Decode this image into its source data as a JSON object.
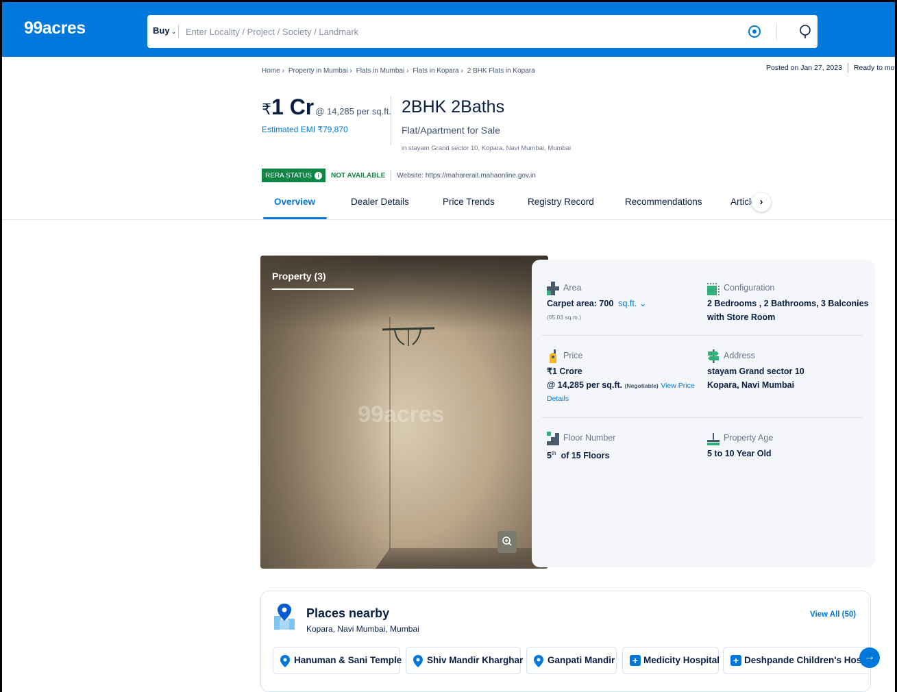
{
  "header": {
    "logo": "99acres",
    "buy_label": "Buy",
    "search_placeholder": "Enter Locality / Project / Society / Landmark"
  },
  "breadcrumb": [
    "Home",
    "Property in Mumbai",
    "Flats in Mumbai",
    "Flats in Kopara",
    "2 BHK Flats in Kopara"
  ],
  "posted": {
    "date": "Posted on Jan 27, 2023",
    "status": "Ready to move"
  },
  "summary": {
    "rupee": "₹",
    "price": "1 Cr",
    "per_sqft": "@ 14,285 per sq.ft.",
    "emi": "Estimated EMI ₹79,870",
    "bhk": "2BHK 2Baths",
    "property_type": "Flat/Apartment for Sale",
    "location": "in stayam Grand sector 10, Kopara, Navi Mumbai, Mumbai"
  },
  "rera": {
    "badge": "RERA STATUS",
    "status": "NOT AVAILABLE",
    "website": "Website: https://maharerait.mahaonline.gov.in"
  },
  "tabs": [
    "Overview",
    "Dealer Details",
    "Price Trends",
    "Registry Record",
    "Recommendations",
    "Article"
  ],
  "gallery": {
    "title": "Property (3)",
    "watermark": "99acres"
  },
  "details": {
    "area": {
      "label": "Area",
      "value": "Carpet area: 700",
      "unit": "sq.ft.",
      "sub": "(65.03 sq.m.)"
    },
    "configuration": {
      "label": "Configuration",
      "line1": "2 Bedrooms , 2 Bathrooms, 3 Balconies",
      "line2": "with Store Room"
    },
    "price": {
      "label": "Price",
      "value": "₹1 Crore",
      "per_sqft": "@ 14,285 per sq.ft.",
      "negotiable": "(Negotiable)",
      "link1": "View Price",
      "link2": "Details"
    },
    "address": {
      "label": "Address",
      "line1": "stayam Grand sector 10",
      "line2": "Kopara, Navi Mumbai"
    },
    "floor": {
      "label": "Floor Number",
      "value": "5",
      "sup": "th",
      "rest": "of 15 Floors"
    },
    "age": {
      "label": "Property Age",
      "value": "5 to 10 Year Old"
    }
  },
  "places": {
    "title": "Places nearby",
    "subtitle": "Kopara, Navi Mumbai, Mumbai",
    "view_all": "View All (50)",
    "chips": [
      {
        "label": "Hanuman & Sani Temple",
        "icon": "pin-icon"
      },
      {
        "label": "Shiv Mandir Kharghar",
        "icon": "pin-icon"
      },
      {
        "label": "Ganpati Mandir",
        "icon": "pin-icon"
      },
      {
        "label": "Medicity Hospital",
        "icon": "hospital-icon"
      },
      {
        "label": "Deshpande Children's Hospital",
        "icon": "hospital-icon"
      }
    ]
  },
  "colors": {
    "brand": "#0078db",
    "rera_green": "#0e8744"
  }
}
